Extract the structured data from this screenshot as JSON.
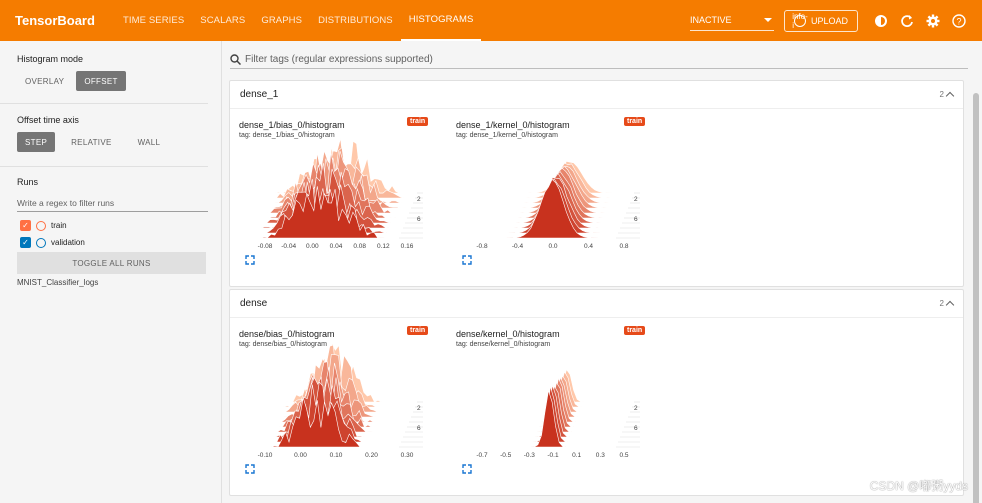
{
  "app": {
    "brand": "TensorBoard",
    "tabs": [
      {
        "label": "TIME SERIES",
        "active": false
      },
      {
        "label": "SCALARS",
        "active": false
      },
      {
        "label": "GRAPHS",
        "active": false
      },
      {
        "label": "DISTRIBUTIONS",
        "active": false
      },
      {
        "label": "HISTOGRAMS",
        "active": true
      }
    ],
    "status_select": "INACTIVE",
    "upload_label": "UPLOAD",
    "upload_icon": "info-i",
    "toolbar_icons": [
      "theme-icon",
      "refresh-icon",
      "settings-icon",
      "help-icon"
    ],
    "accent": "#f57c00"
  },
  "sidebar": {
    "histogram_mode": {
      "title": "Histogram mode",
      "options": [
        "OVERLAY",
        "OFFSET"
      ],
      "selected": "OFFSET"
    },
    "offset_axis": {
      "title": "Offset time axis",
      "options": [
        "STEP",
        "RELATIVE",
        "WALL"
      ],
      "selected": "STEP"
    },
    "runs": {
      "title": "Runs",
      "regex_placeholder": "Write a regex to filter runs",
      "items": [
        {
          "label": "train",
          "checked": true,
          "color": "#ff7043"
        },
        {
          "label": "validation",
          "checked": true,
          "color": "#0077bb"
        }
      ],
      "toggle_label": "TOGGLE ALL RUNS",
      "logdir": "MNIST_Classifier_logs"
    }
  },
  "main": {
    "filter_placeholder": "Filter tags (regular expressions supported)",
    "groups": [
      {
        "name": "dense_1",
        "count": "2",
        "charts": [
          {
            "title": "dense_1/bias_0/histogram",
            "tag": "tag: dense_1/bias_0/histogram",
            "run": "train",
            "x_ticks": [
              "-0.08",
              "-0.04",
              "0.00",
              "0.04",
              "0.08",
              "0.12",
              "0.16"
            ],
            "y_ticks": [
              "2",
              "6"
            ]
          },
          {
            "title": "dense_1/kernel_0/histogram",
            "tag": "tag: dense_1/kernel_0/histogram",
            "run": "train",
            "x_ticks": [
              "-0.8",
              "-0.4",
              "0.0",
              "0.4",
              "0.8"
            ],
            "y_ticks": [
              "2",
              "6"
            ]
          }
        ]
      },
      {
        "name": "dense",
        "count": "2",
        "charts": [
          {
            "title": "dense/bias_0/histogram",
            "tag": "tag: dense/bias_0/histogram",
            "run": "train",
            "x_ticks": [
              "-0.10",
              "0.00",
              "0.10",
              "0.20",
              "0.30"
            ],
            "y_ticks": [
              "2",
              "6"
            ]
          },
          {
            "title": "dense/kernel_0/histogram",
            "tag": "tag: dense/kernel_0/histogram",
            "run": "train",
            "x_ticks": [
              "-0.7",
              "-0.5",
              "-0.3",
              "-0.1",
              "0.1",
              "0.3",
              "0.5"
            ],
            "y_ticks": [
              "2",
              "6"
            ]
          }
        ]
      }
    ]
  },
  "watermark": "CSDN @嘟粥yyds"
}
